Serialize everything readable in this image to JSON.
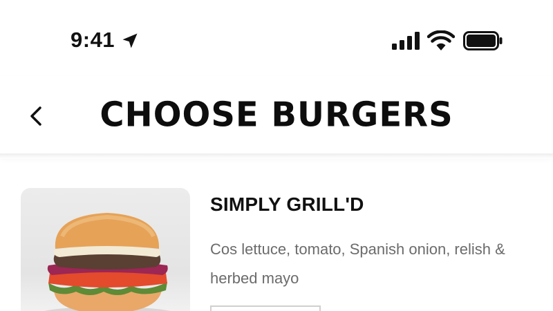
{
  "status_bar": {
    "time": "9:41",
    "icons": [
      "location-arrow-icon",
      "cellular-signal-icon",
      "wifi-icon",
      "battery-icon"
    ]
  },
  "header": {
    "title": "CHOOSE BURGERS",
    "back_icon": "chevron-left-icon"
  },
  "product": {
    "name": "SIMPLY GRILL'D",
    "description": "Cos lettuce, tomato, Spanish onion, relish & herbed mayo",
    "image": "burger-photo"
  },
  "colors": {
    "text_primary": "#111111",
    "text_secondary": "#6b6b6b",
    "background": "#ffffff",
    "image_bg": "#e6e6e6",
    "button_border": "#cfcfcf"
  }
}
